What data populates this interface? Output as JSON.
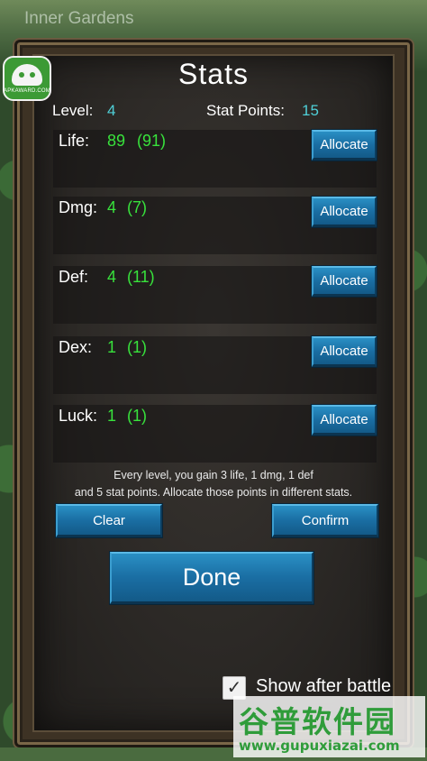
{
  "location": "Inner Gardens",
  "watermark_badge_text": "APKAWARD.COM",
  "title": "Stats",
  "summary": {
    "level_label": "Level:",
    "level_value": "4",
    "points_label": "Stat Points:",
    "points_value": "15"
  },
  "stats": [
    {
      "name": "Life:",
      "value": "89",
      "max": "(91)",
      "button": "Allocate"
    },
    {
      "name": "Dmg:",
      "value": "4",
      "max": "(7)",
      "button": "Allocate"
    },
    {
      "name": "Def:",
      "value": "4",
      "max": "(11)",
      "button": "Allocate"
    },
    {
      "name": "Dex:",
      "value": "1",
      "max": "(1)",
      "button": "Allocate"
    },
    {
      "name": "Luck:",
      "value": "1",
      "max": "(1)",
      "button": "Allocate"
    }
  ],
  "info": {
    "line1": "Every level, you gain 3 life, 1 dmg, 1 def",
    "line2": "and 5 stat points. Allocate those points in different stats."
  },
  "buttons": {
    "clear": "Clear",
    "confirm": "Confirm",
    "done": "Done"
  },
  "show_after_battle": {
    "label": "Show after battle",
    "checked": true,
    "check_glyph": "✓"
  },
  "brand_watermark": {
    "title": "谷普软件园",
    "url": "www.gupuxiazai.com"
  },
  "colors": {
    "stat_value": "#38e23c",
    "summary_value": "#4fd0d8",
    "button": "#1a6ea3"
  }
}
